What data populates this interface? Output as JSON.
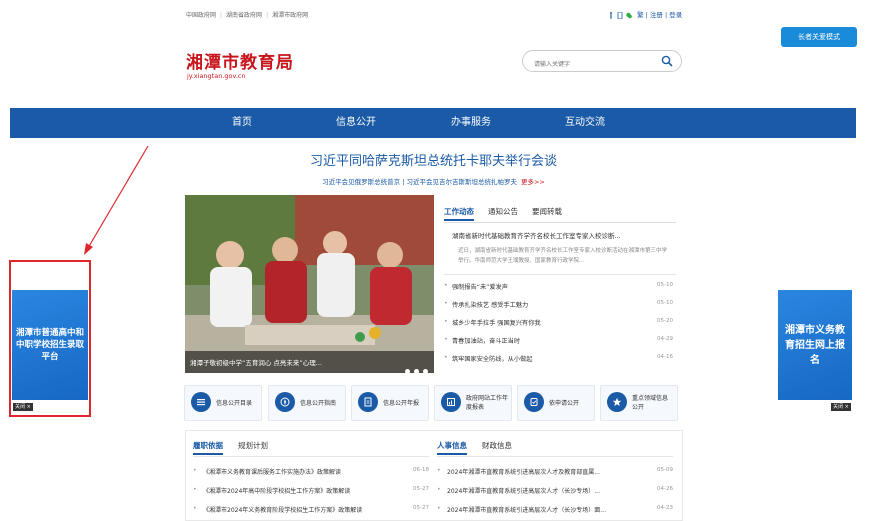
{
  "topbar": {
    "links": [
      "中国政府网",
      "湖南省政府网",
      "湘潭市政府网"
    ],
    "right_links": [
      "繁",
      "注册",
      "登录"
    ]
  },
  "care_mode_button": "长者关爱模式",
  "logo": {
    "title": "湘潭市教育局",
    "subtitle": "jy.xiangtan.gov.cn"
  },
  "search": {
    "placeholder": "请输入关键字"
  },
  "nav": [
    "首页",
    "信息公开",
    "办事服务",
    "互动交流"
  ],
  "headline": {
    "title": "习近平同哈萨克斯坦总统托卡耶夫举行会谈",
    "sub": "习近平会见俄罗斯总统普京 | 习近平会见吉尔吉斯斯坦总统扎帕罗夫",
    "more": "更多>>"
  },
  "slider": {
    "caption": "湘潭子敬初级中学“五育润心 点亮未来”心理..."
  },
  "news": {
    "tabs": [
      "工作动态",
      "通知公告",
      "要闻转载"
    ],
    "featured": {
      "title": "湖南省新时代基础教育齐学齐名校长工作室专家入校诊断...",
      "desc": "近日，湖南省新时代基础教育齐学齐名校长工作室专家入校诊断活动在湘潭市第三中学举行。华南师范大学王璞教授、国家教育行政学院..."
    },
    "items": [
      {
        "title": "强制报告“未”爱发声",
        "date": "05-10"
      },
      {
        "title": "传承扎染技艺 感受手工魅力",
        "date": "05-10"
      },
      {
        "title": "城乡少年手拉手 强国复兴有你我",
        "date": "05-20"
      },
      {
        "title": "青春加油站，奋斗正当时",
        "date": "04-29"
      },
      {
        "title": "筑牢国家安全防线，从小做起",
        "date": "04-16"
      }
    ]
  },
  "services": [
    {
      "label": "信息公开目录",
      "icon": "list-icon"
    },
    {
      "label": "信息公开指南",
      "icon": "compass-icon"
    },
    {
      "label": "信息公开年报",
      "icon": "document-icon"
    },
    {
      "label": "政府网站工作年度报表",
      "icon": "report-icon"
    },
    {
      "label": "依申请公开",
      "icon": "apply-icon"
    },
    {
      "label": "重点领域信息公开",
      "icon": "star-icon"
    }
  ],
  "bottom": {
    "left_tabs": [
      "履职依据",
      "规划计划"
    ],
    "right_tabs": [
      "人事信息",
      "财政信息"
    ],
    "left_items": [
      {
        "title": "《湘潭市义务教育课后服务工作实施办法》政策解读",
        "date": "06-18"
      },
      {
        "title": "《湘潭市2024年高中阶段学校招生工作方案》政策解读",
        "date": "05-27"
      },
      {
        "title": "《湘潭市2024年义务教育阶段学校招生工作方案》政策解读",
        "date": "05-27"
      }
    ],
    "right_items": [
      {
        "title": "2024年湘潭市直教育系统引进高层次人才及教育部直属...",
        "date": "05-09"
      },
      {
        "title": "2024年湘潭市直教育系统引进高层次人才（长沙专场）...",
        "date": "04-26"
      },
      {
        "title": "2024年湘潭市直教育系统引进高层次人才（长沙专场）面...",
        "date": "04-23"
      }
    ]
  },
  "ads": {
    "left": "湘潭市普通高中和中职学校招生录取平台",
    "right": "湘潭市义务教育招生网上报名",
    "close": "关闭 ×"
  },
  "colors": {
    "brand_red": "#c8161d",
    "nav_blue": "#1a5aa6",
    "ad_blue": "#1d75d6",
    "annotation_red": "#e0262d"
  }
}
